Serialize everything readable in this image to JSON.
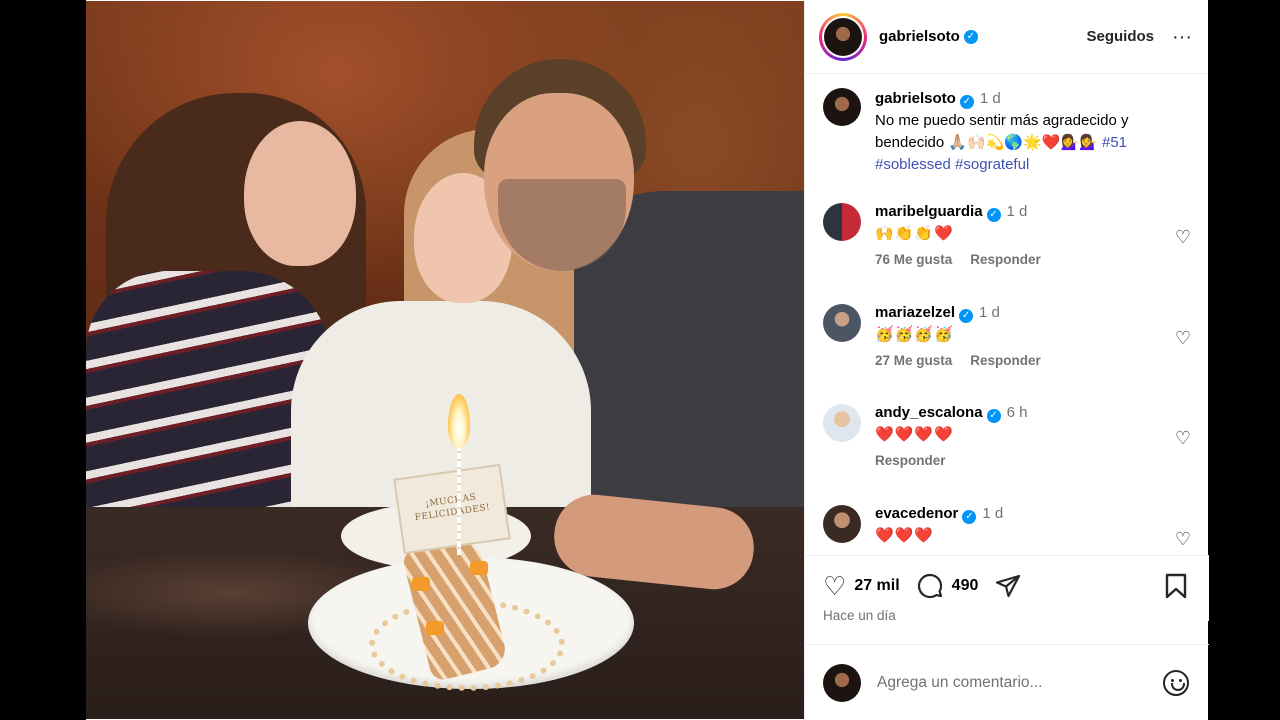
{
  "colors": {
    "verified": "#0095f6",
    "hashtag": "#4051b5",
    "muted": "#737373",
    "border": "#efefef"
  },
  "header": {
    "username": "gabrielsoto",
    "follow_label": "Seguidos",
    "more_icon": "more-icon"
  },
  "photo": {
    "card_text": "¡MUCHAS FELICIDADES!"
  },
  "caption": {
    "username": "gabrielsoto",
    "time": "1 d",
    "text": "No me puedo sentir más agradecido y bendecido 🙏🏼🙌🏻💫🌎🌟❤️💁‍♀️💁‍♀️",
    "hashtags": "#51 #soblessed #sograteful"
  },
  "comments": [
    {
      "username": "maribelguardia",
      "time": "1 d",
      "text": "🙌👏👏❤️",
      "likes": "76 Me gusta",
      "reply": "Responder"
    },
    {
      "username": "mariazelzel",
      "time": "1 d",
      "text": "🥳🥳🥳🥳",
      "likes": "27 Me gusta",
      "reply": "Responder"
    },
    {
      "username": "andy_escalona",
      "time": "6 h",
      "text": "❤️❤️❤️❤️",
      "likes": "",
      "reply": "Responder"
    },
    {
      "username": "evacedenor",
      "time": "1 d",
      "text": "❤️❤️❤️",
      "likes": "",
      "reply": ""
    }
  ],
  "actions": {
    "likes": "27 mil",
    "comments": "490",
    "date_label": "Hace un día"
  },
  "add_comment": {
    "placeholder": "Agrega un comentario..."
  }
}
